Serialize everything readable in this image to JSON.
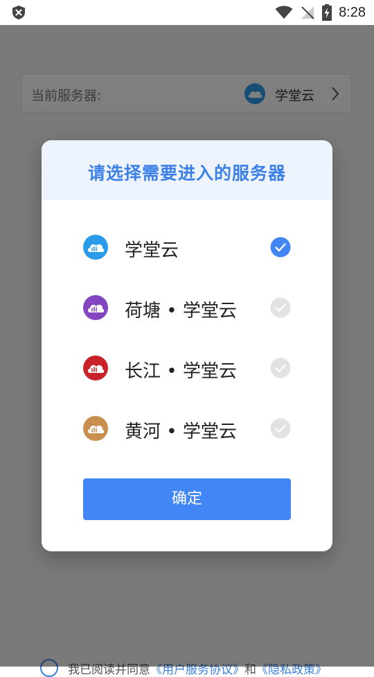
{
  "status_bar": {
    "time": "8:28"
  },
  "background": {
    "server_label": "当前服务器:",
    "current_server": "学堂云",
    "agreement": {
      "prefix": "我已阅读并同意",
      "link1": "《用户服务协议》",
      "and": "和",
      "link2": "《隐私政策》"
    }
  },
  "dialog": {
    "title": "请选择需要进入的服务器",
    "options": [
      {
        "label": "学堂云",
        "color": "#2a9be8",
        "selected": true
      },
      {
        "label": "荷塘 • 学堂云",
        "color": "#8446c0",
        "selected": false
      },
      {
        "label": "长江 • 学堂云",
        "color": "#c8232b",
        "selected": false
      },
      {
        "label": "黄河 • 学堂云",
        "color": "#c98f4e",
        "selected": false
      }
    ],
    "confirm_label": "确定"
  },
  "colors": {
    "accent": "#4285f4",
    "title": "#3d80e6",
    "check_on": "#4285f4",
    "check_off": "#e2e2e2"
  },
  "icons": [
    "shield-x-icon",
    "wifi-icon",
    "no-signal-icon",
    "battery-charging-icon",
    "cloud-logo-icon",
    "chevron-right-icon",
    "check-circle-icon"
  ]
}
